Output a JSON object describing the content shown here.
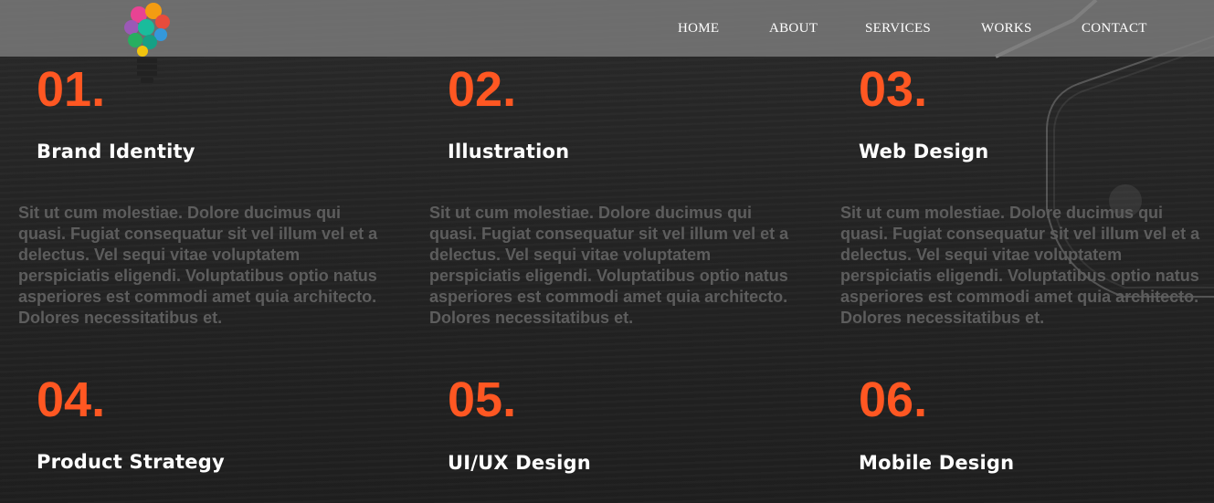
{
  "nav": {
    "items": [
      {
        "label": "HOME"
      },
      {
        "label": "ABOUT"
      },
      {
        "label": "SERVICES"
      },
      {
        "label": "WORKS"
      },
      {
        "label": "CONTACT"
      }
    ]
  },
  "colors": {
    "accent": "#ff5722",
    "navbar": "#7d7d7d",
    "background": "#222222",
    "body_text": "#5d5d5d",
    "title_text": "#ffffff"
  },
  "logo": {
    "icon": "lightbulb-logo-icon"
  },
  "services": [
    {
      "number": "01.",
      "title": "Brand Identity",
      "description": "Sit ut cum molestiae. Dolore ducimus qui quasi. Fugiat consequatur sit vel illum vel et a delectus. Vel sequi vitae voluptatem perspiciatis eligendi. Voluptatibus optio natus asperiores est commodi amet quia architecto. Dolores necessitatibus et."
    },
    {
      "number": "02.",
      "title": "Illustration",
      "description": "Sit ut cum molestiae. Dolore ducimus qui quasi. Fugiat consequatur sit vel illum vel et a delectus. Vel sequi vitae voluptatem perspiciatis eligendi. Voluptatibus optio natus asperiores est commodi amet quia architecto. Dolores necessitatibus et."
    },
    {
      "number": "03.",
      "title": "Web Design",
      "description": "Sit ut cum molestiae. Dolore ducimus qui quasi. Fugiat consequatur sit vel illum vel et a delectus. Vel sequi vitae voluptatem perspiciatis eligendi. Voluptatibus optio natus asperiores est commodi amet quia architecto. Dolores necessitatibus et."
    },
    {
      "number": "04.",
      "title": "Product Strategy"
    },
    {
      "number": "05.",
      "title": "UI/UX Design"
    },
    {
      "number": "06.",
      "title": "Mobile Design"
    }
  ]
}
